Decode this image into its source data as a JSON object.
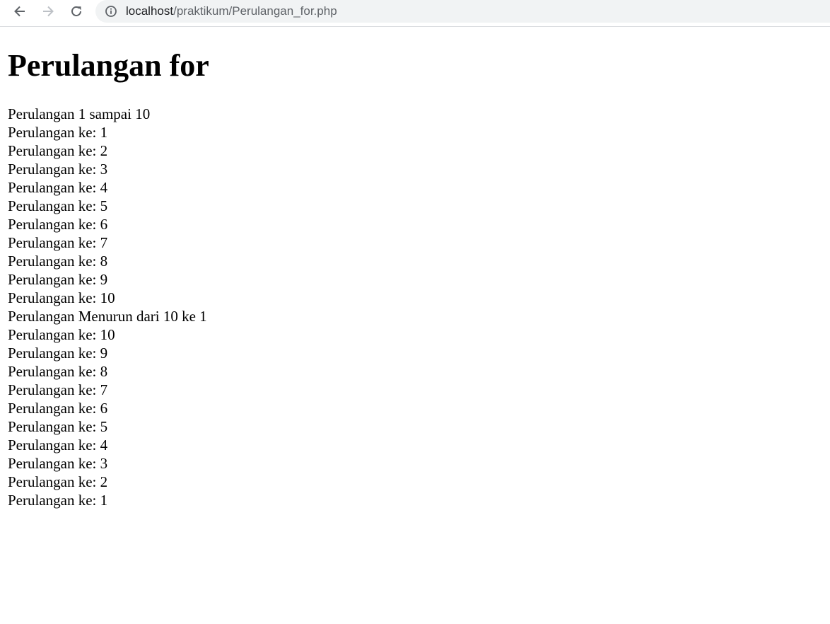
{
  "browser": {
    "url_host": "localhost",
    "url_path": "/praktikum/Perulangan_for.php"
  },
  "page": {
    "title": "Perulangan for",
    "lines": [
      "Perulangan 1 sampai 10",
      "Perulangan ke: 1",
      "Perulangan ke: 2",
      "Perulangan ke: 3",
      "Perulangan ke: 4",
      "Perulangan ke: 5",
      "Perulangan ke: 6",
      "Perulangan ke: 7",
      "Perulangan ke: 8",
      "Perulangan ke: 9",
      "Perulangan ke: 10",
      "Perulangan Menurun dari 10 ke 1",
      "Perulangan ke: 10",
      "Perulangan ke: 9",
      "Perulangan ke: 8",
      "Perulangan ke: 7",
      "Perulangan ke: 6",
      "Perulangan ke: 5",
      "Perulangan ke: 4",
      "Perulangan ke: 3",
      "Perulangan ke: 2",
      "Perulangan ke: 1"
    ]
  },
  "icons": {
    "back": "arrow-left-icon",
    "forward": "arrow-right-icon",
    "reload": "reload-icon",
    "info": "info-circle-icon"
  },
  "colors": {
    "icon_active": "#5f6368",
    "icon_disabled": "#bdc1c6",
    "omnibox_bg": "#f1f3f4"
  }
}
